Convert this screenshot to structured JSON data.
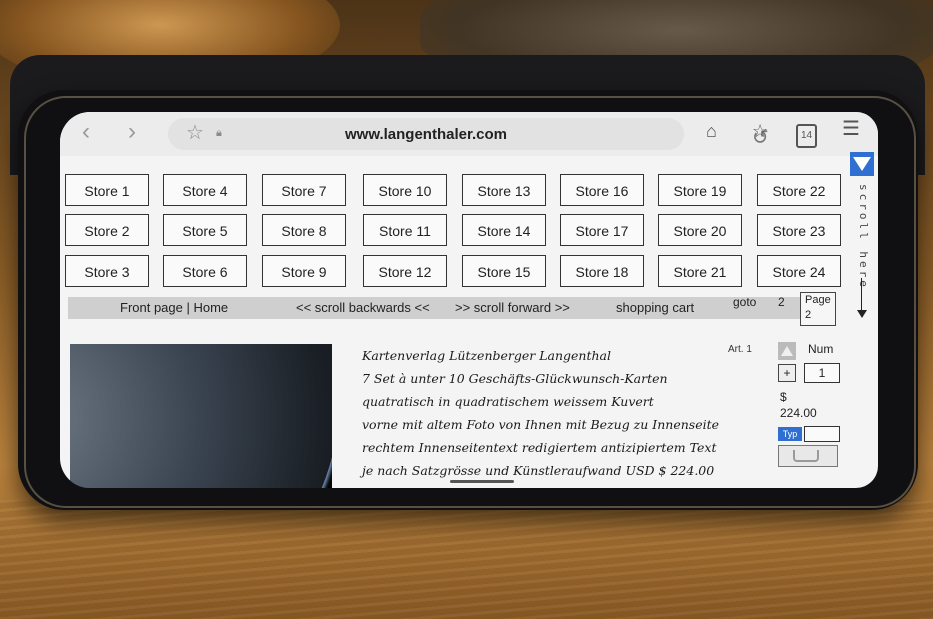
{
  "browser": {
    "url": "www.langenthaler.com",
    "back_icon": "chevron-left-icon",
    "forward_icon": "chevron-right-icon",
    "star_icon": "star-icon",
    "lock_icon": "lock-icon",
    "reload_icon": "reload-icon",
    "home_icon": "home-icon",
    "bookmarks_icon": "bookmarks-icon",
    "tabs_count": "14",
    "menu_icon": "menu-icon"
  },
  "stores": [
    "Store 1",
    "Store 2",
    "Store 3",
    "Store 4",
    "Store 5",
    "Store 6",
    "Store 7",
    "Store 8",
    "Store 9",
    "Store 10",
    "Store 11",
    "Store 12",
    "Store 13",
    "Store 14",
    "Store 15",
    "Store 16",
    "Store 17",
    "Store 18",
    "Store 19",
    "Store 20",
    "Store 21",
    "Store 22",
    "Store 23",
    "Store 24"
  ],
  "side": {
    "scroll_label": "scroll here"
  },
  "nav": {
    "front_page": "Front page | Home",
    "scroll_back": "<< scroll backwards <<",
    "scroll_forward": ">> scroll forward >>",
    "shopping_cart": "shopping cart",
    "goto": "goto",
    "goto_value": "2",
    "page_label": "Page",
    "page_value": "2"
  },
  "product": {
    "lines": [
      "Kartenverlag Lützenberger Langenthal",
      "7 Set à unter 10 Geschäfts-Glückwunsch-Karten",
      "quatratisch in quadratischem weissem Kuvert",
      "vorne mit altem Foto von Ihnen mit Bezug zu Innenseite",
      "rechtem Innenseitentext redigiertem antizipiertem Text",
      "je nach Satzgrösse und Künstleraufwand USD $ 224.00"
    ],
    "art": "Art. 1",
    "num_label": "Num",
    "plus": "+",
    "quantity": "1",
    "currency": "$",
    "price": "224.00",
    "typ_label": "Typ",
    "cart_icon": "cart-icon"
  }
}
